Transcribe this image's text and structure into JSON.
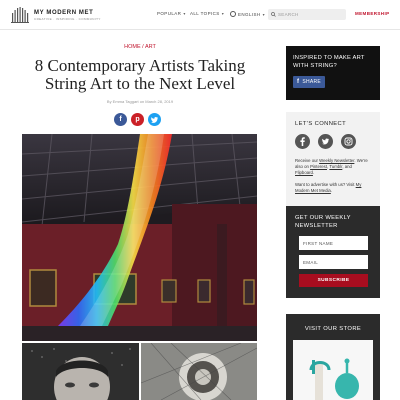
{
  "header": {
    "logo_name": "MY MODERN MET",
    "logo_tagline": "CREATIVE  ·  INSPIRING  ·  COMMUNITY",
    "nav": [
      {
        "label": "POPULAR"
      },
      {
        "label": "ALL TOPICS"
      },
      {
        "label": "ENGLISH"
      }
    ],
    "search_placeholder": "SEARCH",
    "membership_label": "MEMBERSHIP"
  },
  "article": {
    "breadcrumb_home": "HOME",
    "breadcrumb_sep": " / ",
    "breadcrumb_category": "ART",
    "title": "8 Contemporary Artists Taking String Art to the Next Level",
    "byline": "By Emma Taggart on March 28, 2019"
  },
  "sidebar": {
    "promo_text": "INSPIRED TO MAKE ART WITH STRING?",
    "promo_share_label": "SHARE",
    "connect_title": "LET'S CONNECT",
    "connect_copy": {
      "prefix": "Receive our ",
      "newsletter_link": "Weekly Newsletter",
      "mid": ". We're also on ",
      "pinterest": "Pinterest",
      "comma": ", ",
      "tumblr": "Tumblr",
      "and": ", and ",
      "flipboard": "Flipboard",
      "end": "."
    },
    "advertise_copy": {
      "prefix": "Want to advertise with us? Visit ",
      "link": "My Modern Met Media",
      "end": "."
    },
    "newsletter_title": "GET OUR WEEKLY NEWSLETTER",
    "first_name_placeholder": "FIRST NAME",
    "email_placeholder": "EMAIL",
    "subscribe_label": "SUBSCRIBE",
    "store_title": "VISIT OUR STORE"
  },
  "icons": {
    "facebook": "facebook-icon",
    "pinterest": "pinterest-icon",
    "twitter": "twitter-icon",
    "instagram": "instagram-icon",
    "search": "search-icon",
    "globe": "globe-icon"
  },
  "colors": {
    "brand_red": "#c0142d",
    "facebook_blue": "#3b5998",
    "pinterest_red": "#cb2027",
    "twitter_blue": "#1da1f2",
    "promo_bg": "#111111",
    "newsletter_bg": "#2b2b2b"
  }
}
